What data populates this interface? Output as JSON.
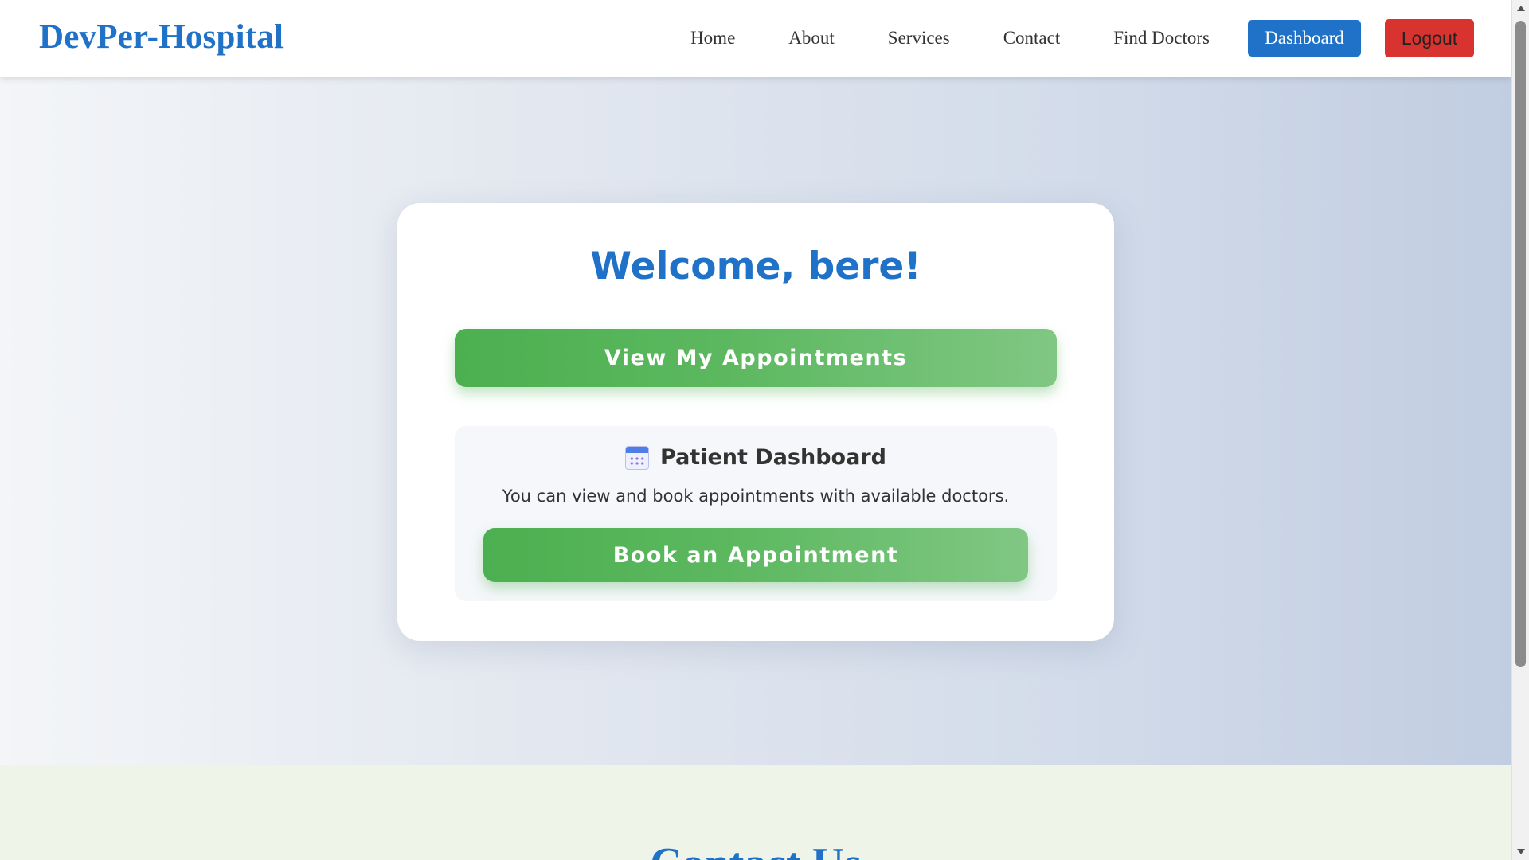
{
  "header": {
    "brand": "DevPer-Hospital",
    "nav": {
      "home": "Home",
      "about": "About",
      "services": "Services",
      "contact": "Contact",
      "find_doctors": "Find Doctors"
    },
    "dashboard_label": "Dashboard",
    "logout_label": "Logout"
  },
  "main": {
    "welcome": "Welcome, bere!",
    "view_appointments_label": "View My Appointments",
    "panel": {
      "icon": "calendar-icon",
      "title": "Patient Dashboard",
      "description": "You can view and book appointments with available doctors.",
      "book_label": "Book an Appointment"
    }
  },
  "contact": {
    "heading": "Contact Us"
  },
  "colors": {
    "brand_blue": "#1f72c8",
    "logout_red": "#d9332f",
    "button_green": "#4caf50",
    "contact_bg": "#eef5e8"
  }
}
